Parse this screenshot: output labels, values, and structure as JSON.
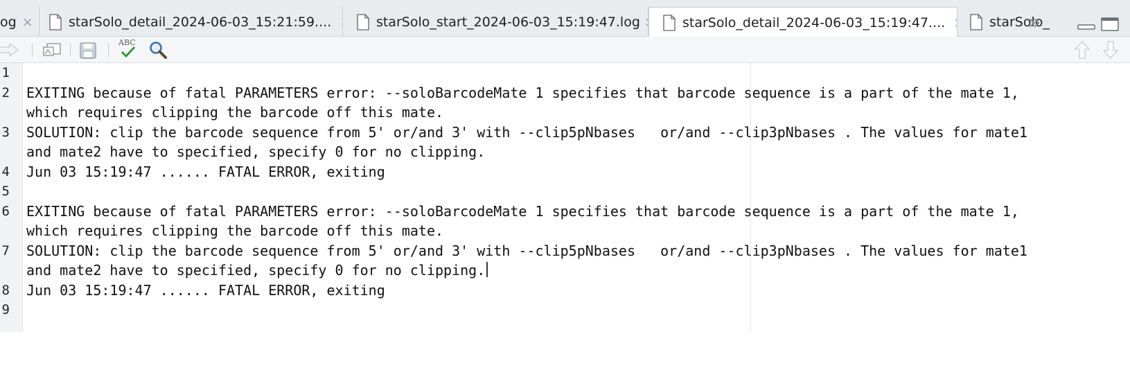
{
  "tabs": [
    {
      "label": "og",
      "active": false
    },
    {
      "label": "starSolo_detail_2024-06-03_15:21:59....",
      "active": false
    },
    {
      "label": "starSolo_start_2024-06-03_15:19:47.log",
      "active": false
    },
    {
      "label": "starSolo_detail_2024-06-03_15:19:47....",
      "active": true
    },
    {
      "label": "starSolo_",
      "active": false
    }
  ],
  "close_glyph": "×",
  "more_tabs_glyph": "»",
  "toolbar": {
    "spellcheck_label": "ABC"
  },
  "editor": {
    "line_numbers": [
      "1",
      "2",
      "3",
      "4",
      "5",
      "6",
      "7",
      "8",
      "9"
    ],
    "lines": [
      {
        "num": "1",
        "rows": [
          ""
        ]
      },
      {
        "num": "2",
        "rows": [
          "EXITING because of fatal PARAMETERS error: --soloBarcodeMate 1 specifies that barcode sequence is a part of the mate 1,",
          "which requires clipping the barcode off this mate."
        ]
      },
      {
        "num": "3",
        "rows": [
          "SOLUTION: clip the barcode sequence from 5' or/and 3' with --clip5pNbases   or/and --clip3pNbases . The values for mate1",
          "and mate2 have to specified, specify 0 for no clipping."
        ]
      },
      {
        "num": "4",
        "rows": [
          "Jun 03 15:19:47 ...... FATAL ERROR, exiting"
        ]
      },
      {
        "num": "5",
        "rows": [
          ""
        ]
      },
      {
        "num": "6",
        "rows": [
          "EXITING because of fatal PARAMETERS error: --soloBarcodeMate 1 specifies that barcode sequence is a part of the mate 1,",
          "which requires clipping the barcode off this mate."
        ]
      },
      {
        "num": "7",
        "rows": [
          "SOLUTION: clip the barcode sequence from 5' or/and 3' with --clip5pNbases   or/and --clip3pNbases . The values for mate1",
          "and mate2 have to specified, specify 0 for no clipping."
        ]
      },
      {
        "num": "8",
        "rows": [
          "Jun 03 15:19:47 ...... FATAL ERROR, exiting"
        ]
      },
      {
        "num": "9",
        "rows": [
          ""
        ]
      }
    ]
  },
  "colors": {
    "tabbar_bg": "#e9ecef",
    "toolbar_bg": "#f5f6f7",
    "gutter_bg": "#f1f2f3",
    "spell_check_green": "#2e9e3a",
    "search_blue": "#3a6fb5"
  }
}
